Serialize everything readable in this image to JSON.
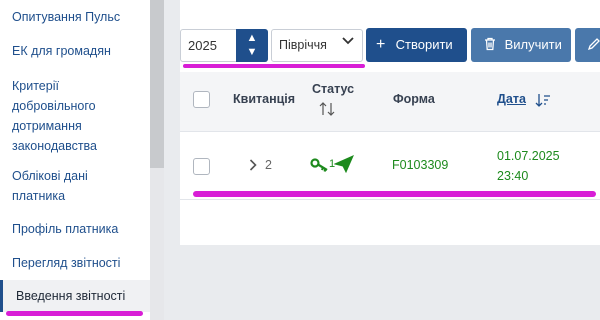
{
  "sidebar": {
    "items": [
      {
        "label": "Опитування Пульс"
      },
      {
        "label": "ЕК для громадян"
      },
      {
        "label": "Критерії добровільного дотримання законодавства"
      },
      {
        "label": "Облікові дані платника"
      },
      {
        "label": "Профіль платника"
      },
      {
        "label": "Перегляд звітності"
      },
      {
        "label": "Введення звітності"
      }
    ]
  },
  "toolbar": {
    "year_value": "2025",
    "period_value": "Півріччя",
    "create_label": "Створити",
    "delete_label": "Вилучити"
  },
  "table": {
    "headers": {
      "receipt": "Квитанція",
      "status": "Статус",
      "form": "Форма",
      "date": "Дата"
    },
    "rows": [
      {
        "receipt_count": "2",
        "status_count": "1",
        "form": "F0103309",
        "date": "01.07.2025",
        "time": "23:40"
      }
    ]
  },
  "colors": {
    "accent": "#1f4f8c",
    "secondary_button": "#4a78ab",
    "status_green": "#1d8a1d",
    "highlight": "#d81ed6"
  },
  "icons": {
    "year_up": "chevron-up-icon",
    "year_down": "chevron-down-icon",
    "period": "chevron-down-icon",
    "create": "plus-icon",
    "delete": "trash-icon",
    "edit": "pencil-icon",
    "expand": "chevron-right-icon",
    "status_key": "key-icon",
    "status_sent": "paper-plane-icon",
    "sort_status": "sort-arrows-icon",
    "sort_date": "sort-desc-icon"
  }
}
